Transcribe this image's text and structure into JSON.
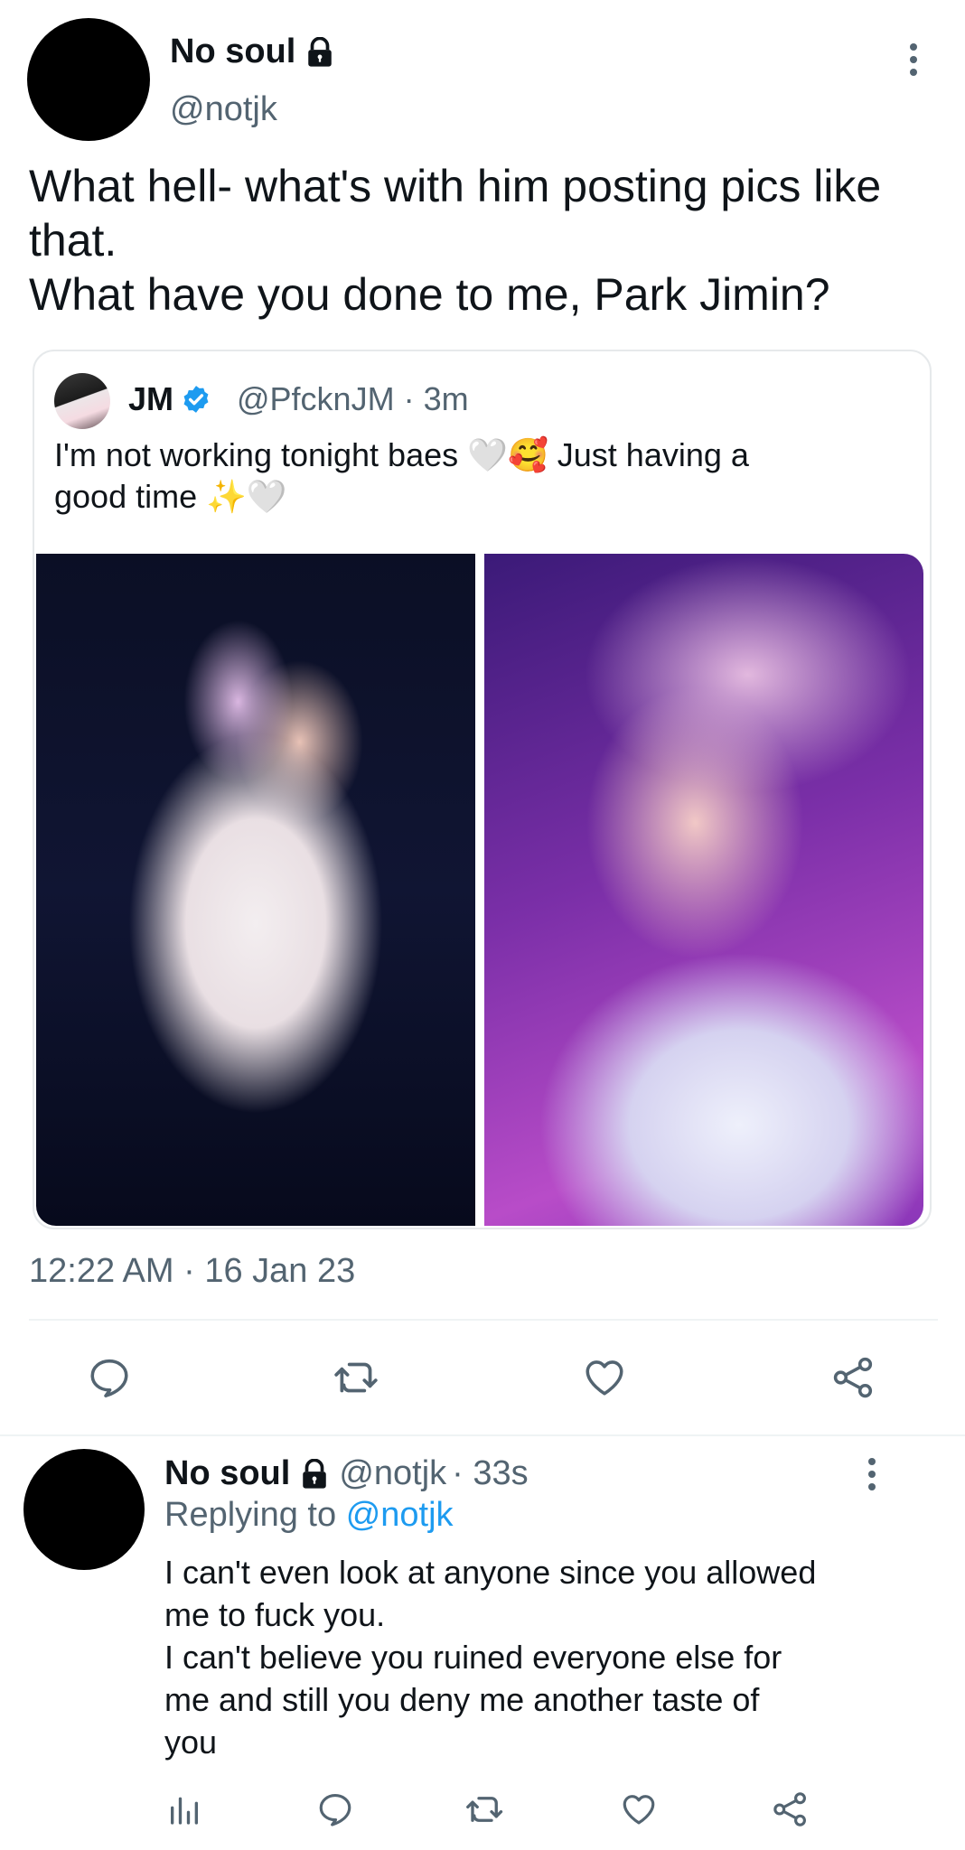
{
  "main_tweet": {
    "author_name": "No soul",
    "author_handle": "@notjk",
    "text_lines": [
      "What hell- what's with him posting pics like",
      "that.",
      "What have you done to me, Park Jimin?"
    ],
    "timestamp": "12:22 AM · 16 Jan 23"
  },
  "quoted_tweet": {
    "author_name": "JM",
    "author_handle": "@PfcknJM",
    "time": "· 3m",
    "text_line1": "I'm not working tonight baes 🤍🥰 Just having a",
    "text_line2": "good time ✨🤍"
  },
  "reply": {
    "author_name": "No soul",
    "author_handle": "@notjk",
    "time": "· 33s",
    "replying_prefix": "Replying to",
    "replying_handle": "@notjk",
    "text_lines": [
      "I can't even look at anyone since you allowed",
      "me to fuck you.",
      "I can't believe you ruined everyone else for",
      "me and still you deny me another taste of",
      "you"
    ]
  },
  "icons": {
    "lock": "lock-icon",
    "verified": "verified-badge-icon",
    "more": "more-options-icon",
    "reply": "reply-icon",
    "retweet": "retweet-icon",
    "like": "like-icon",
    "share": "share-icon",
    "analytics": "analytics-icon"
  },
  "colors": {
    "text": "#0f1419",
    "secondary": "#536471",
    "link": "#1d9bf0",
    "verified": "#1d9bf0",
    "divider": "#eff3f4"
  }
}
